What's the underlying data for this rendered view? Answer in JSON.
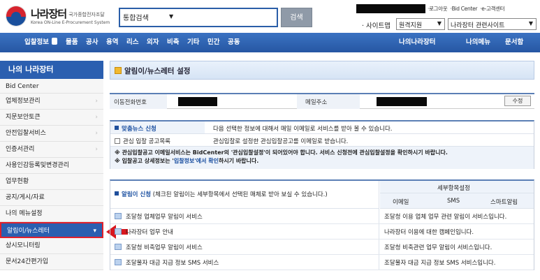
{
  "header": {
    "logo_title": "나라장터",
    "logo_title_small": "국가종합전자조달",
    "logo_sub": "Korea ON-Line E-Procurement System",
    "search_select": "통합검색",
    "search_button": "검색",
    "top_links": [
      "·로그아웃",
      "·Bid Center",
      "·e-고객센터"
    ],
    "sitemap_label": "· 사이트맵",
    "select_region": "원격지원",
    "select_related": "나라장터 관련사이트"
  },
  "nav": {
    "items": [
      "입찰정보",
      "물품",
      "공사",
      "용역",
      "리스",
      "외자",
      "비축",
      "기타",
      "민간",
      "공동"
    ],
    "right_items": [
      "나의나라장터",
      "나의메뉴",
      "문서함"
    ]
  },
  "sidebar": {
    "title": "나의 나라장터",
    "items": [
      {
        "label": "Bid Center",
        "chevron": false
      },
      {
        "label": "업체정보관리",
        "chevron": true
      },
      {
        "label": "지문보안토큰",
        "chevron": true
      },
      {
        "label": "안전입찰서비스",
        "chevron": true
      },
      {
        "label": "인증서관리",
        "chevron": true
      },
      {
        "label": "사용인감등록및변경관리",
        "chevron": false
      },
      {
        "label": "업무현황",
        "chevron": false
      },
      {
        "label": "공지/게시/자료",
        "chevron": false
      },
      {
        "label": "나의 메뉴설정",
        "chevron": false
      },
      {
        "label": "알림이/뉴스레터",
        "chevron": true
      },
      {
        "label": "상시모니터링",
        "chevron": false
      },
      {
        "label": "문서24간편가입",
        "chevron": false
      }
    ]
  },
  "content": {
    "page_title": "알림이/뉴스레터 설정",
    "phone_label": "이동전화번호",
    "email_label": "메일주소",
    "edit_button": "수정",
    "news_title": "맞춤뉴스 신청",
    "news_desc": "다음 선택한 정보에 대해서 매일 이메일로 서비스를 받아 볼 수 있습니다.",
    "bid_notice_label": "관심 입찰 공고목록",
    "bid_notice_desc": "관심입찰로 설정한 관심입찰공고를 이메일로 받습니다.",
    "note1_prefix": "※ 관심입찰공고 이메일서비스는 BidCenter의 '관심입찰설정'이 되어있어야 합니다. 서비스 신청전에 관심입찰설정을 확인하시기 바랍니다.",
    "note2_prefix": "※ 입찰공고 상세정보는 '",
    "note2_link": "입찰정보'에서 확인",
    "note2_suffix": "하시기 바랍니다.",
    "alarm_title": "알림이 신청",
    "alarm_desc": "(체크된 알림이는 세부항목에서 선택된 매체로 받아 보실 수 있습니다.)",
    "detail_header": "세부항목설정",
    "detail_cols": [
      "이메일",
      "SMS",
      "스마트알림"
    ],
    "rows": [
      {
        "label": "조달청 업체업무 알림이 서비스",
        "desc": "조달청 이용 업체 업무 관련 알림이 서비스입니다."
      },
      {
        "label": "나라장터 업무 안내",
        "desc": "나라장터 이용에 대한 캠페인입니다."
      },
      {
        "label": "조달청 비축업무 알림이 서비스",
        "desc": "조달청 비축관련 업무 알림이 서비스입니다."
      },
      {
        "label": "조달물자 대금 지급 정보 SMS 서비스",
        "desc": "조달물자 대금 지급 정보 SMS 서비스입니다."
      }
    ]
  }
}
